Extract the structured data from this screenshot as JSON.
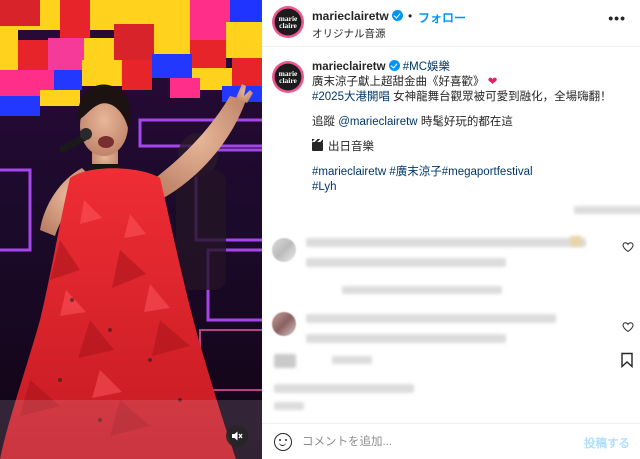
{
  "account": {
    "avatar_text": "marie claire",
    "username": "marieclairetw",
    "separator": "•",
    "follow_label": "フォロー",
    "audio_label": "オリジナル音源",
    "more_label": "•••"
  },
  "caption": {
    "username": "marieclairetw",
    "tag_label": "#MC娛樂",
    "line1": "廣末涼子獻上超甜金曲《好喜歡》",
    "heart_emoji": "❤",
    "line2_tag": "#2025大港開唱",
    "line2_text": " 女神龍舞台觀眾被可愛到融化，全場嗨翻！",
    "line3_prefix": "追蹤 ",
    "line3_mention": "@marieclairetw",
    "line3_suffix": " 時髦好玩的都在這",
    "music_label": "出日音樂",
    "tags": [
      "#marieclairetw",
      "#廣末涼子",
      "#megaportfestival",
      "#Lyh"
    ]
  },
  "icons": {
    "verified": "verified-badge-icon",
    "mute": "speaker-muted-icon",
    "clapper": "clapperboard-icon",
    "heart": "heart-outline-icon",
    "emoji": "emoji-smile-icon",
    "save": "bookmark-icon"
  },
  "footer": {
    "comment_placeholder": "コメントを追加...",
    "post_label": "投稿する"
  },
  "colors": {
    "link_blue": "#00376b",
    "follow_blue": "#0095f6",
    "post_disabled": "#b2dffc",
    "dress_red": "#e8262c"
  }
}
